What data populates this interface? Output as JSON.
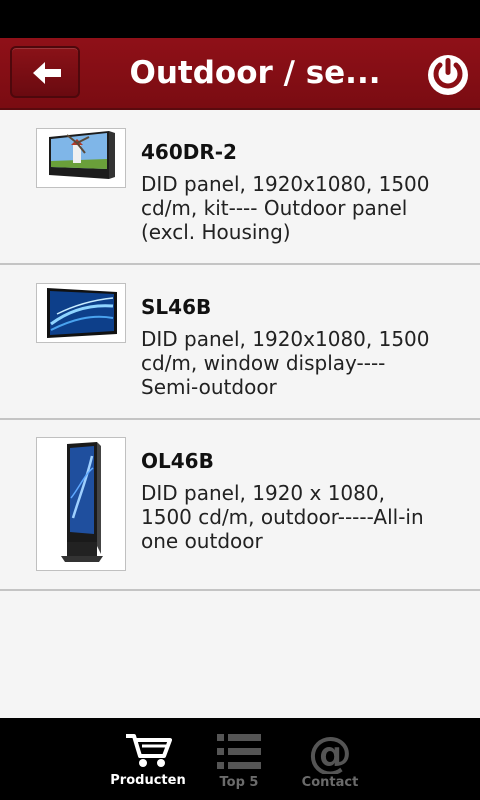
{
  "header": {
    "title": "Outdoor / se...",
    "back_icon": "arrow-left-icon",
    "power_icon": "power-icon",
    "color": "#8f1018"
  },
  "products": [
    {
      "name": "460DR-2",
      "description": "DID panel, 1920x1080, 1500 cd/m, kit---- Outdoor panel (excl. Housing)",
      "thumbnail": "windmill-panel-image"
    },
    {
      "name": "SL46B",
      "description": "DID panel, 1920x1080, 1500 cd/m, window display---- Semi-outdoor",
      "thumbnail": "blue-wave-panel-image"
    },
    {
      "name": "OL46B",
      "description": "DID panel, 1920 x 1080, 1500 cd/m, outdoor-----All-in one outdoor",
      "thumbnail": "standing-kiosk-image"
    }
  ],
  "tabs": [
    {
      "label": "Producten",
      "icon": "cart-icon",
      "active": true
    },
    {
      "label": "Top 5",
      "icon": "list-icon",
      "active": false
    },
    {
      "label": "Contact",
      "icon": "at-icon",
      "active": false
    }
  ]
}
